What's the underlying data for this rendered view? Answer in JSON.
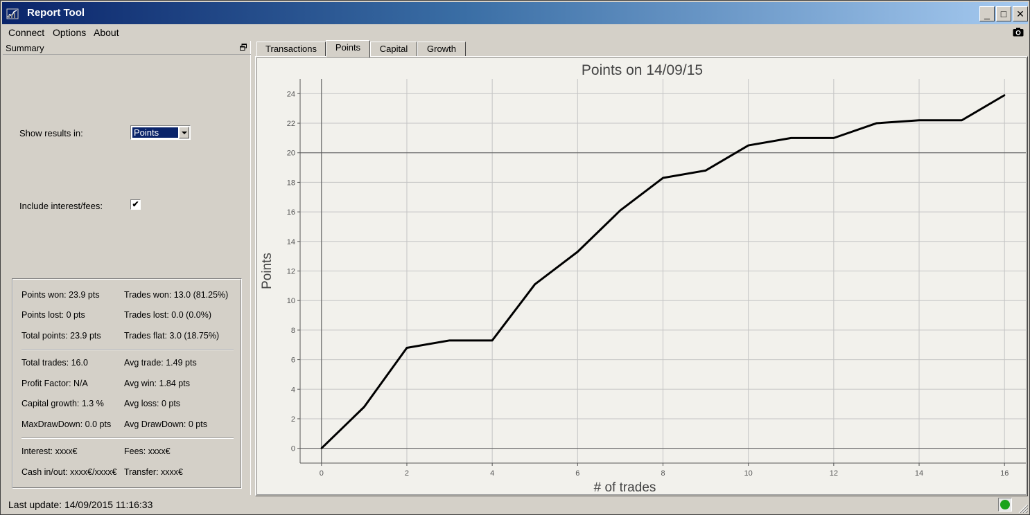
{
  "window": {
    "title": "Report Tool"
  },
  "window_buttons": {
    "minimize": "_",
    "maximize": "□",
    "close": "✕"
  },
  "menu": {
    "items": [
      "Connect",
      "Options",
      "About"
    ]
  },
  "icons": {
    "app": "chart-icon",
    "camera": "camera-icon",
    "float": "float-icon"
  },
  "summary": {
    "title": "Summary",
    "show_results_label": "Show results in:",
    "show_results_value": "Points",
    "include_fees_label": "Include interest/fees:",
    "include_fees_checked": "✔",
    "stats": {
      "points_won": "Points won: 23.9 pts",
      "trades_won": "Trades won: 13.0 (81.25%)",
      "points_lost": "Points lost: 0 pts",
      "trades_lost": "Trades lost: 0.0 (0.0%)",
      "total_points": "Total points: 23.9 pts",
      "trades_flat": "Trades flat: 3.0 (18.75%)",
      "total_trades": "Total trades: 16.0",
      "avg_trade": "Avg trade: 1.49 pts",
      "profit_factor": "Profit Factor: N/A",
      "avg_win": "Avg win: 1.84 pts",
      "capital_growth": "Capital growth: 1.3 %",
      "avg_loss": "Avg loss: 0 pts",
      "max_drawdown": "MaxDrawDown: 0.0 pts",
      "avg_drawdown": "Avg DrawDown: 0 pts",
      "interest": "Interest: xxxx€",
      "fees": "Fees: xxxx€",
      "cash_inout": "Cash in/out: xxxx€/xxxx€",
      "transfer": "Transfer: xxxx€"
    }
  },
  "status": {
    "last_update": "Last update: 14/09/2015 11:16:33",
    "led_color": "#1aa31a"
  },
  "tabs": [
    {
      "label": "Transactions",
      "active": false
    },
    {
      "label": "Points",
      "active": true
    },
    {
      "label": "Capital",
      "active": false
    },
    {
      "label": "Growth",
      "active": false
    }
  ],
  "chart_data": {
    "type": "line",
    "title": "Points on 14/09/15",
    "xlabel": "# of trades",
    "ylabel": "Points",
    "xlim": [
      -0.5,
      16.5
    ],
    "ylim": [
      -1,
      25
    ],
    "xticks": [
      0,
      2,
      4,
      6,
      8,
      10,
      12,
      14,
      16
    ],
    "yticks": [
      0,
      2,
      4,
      6,
      8,
      10,
      12,
      14,
      16,
      18,
      20,
      22,
      24
    ],
    "grid": true,
    "series": [
      {
        "x": [
          0,
          1,
          2,
          3,
          4,
          5,
          6,
          7,
          8,
          9,
          10,
          11,
          12,
          13,
          14,
          15,
          16
        ],
        "values": [
          0,
          2.8,
          6.8,
          7.3,
          7.3,
          11.1,
          13.3,
          16.1,
          18.3,
          18.8,
          20.5,
          21.0,
          21.0,
          22.0,
          22.2,
          22.2,
          23.9
        ]
      }
    ],
    "line_color": "#000000"
  }
}
